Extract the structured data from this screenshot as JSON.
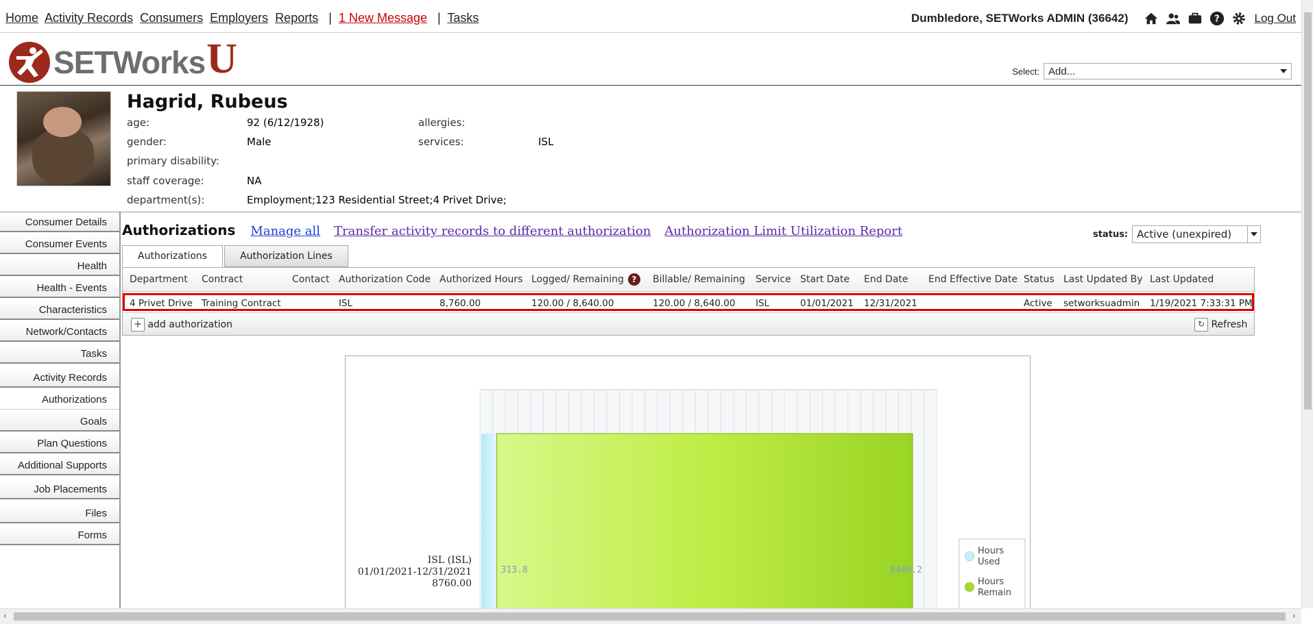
{
  "nav": {
    "home": "Home",
    "activity_records": "Activity Records",
    "consumers": "Consumers",
    "employers": "Employers",
    "reports": "Reports",
    "sep": "|",
    "new_message": "1 New Message",
    "tasks": "Tasks",
    "user": "Dumbledore, SETWorks ADMIN  (36642)",
    "logout": "Log Out"
  },
  "logo": {
    "word": "SETWorks",
    "u": "U"
  },
  "select": {
    "label": "Select:",
    "value": "Add..."
  },
  "consumer": {
    "name": "Hagrid, Rubeus",
    "age_label": "age:",
    "age": "92 (6/12/1928)",
    "allergies_label": "allergies:",
    "allergies": "",
    "gender_label": "gender:",
    "gender": "Male",
    "services_label": "services:",
    "services": "ISL",
    "primary_disability_label": "primary disability:",
    "primary_disability": "",
    "staff_coverage_label": "staff coverage:",
    "staff_coverage": "NA",
    "departments_label": "department(s):",
    "departments": "Employment;123 Residential Street;4 Privet Drive;"
  },
  "sidebar": {
    "items": [
      {
        "label": "Consumer Details"
      },
      {
        "label": "Consumer Events"
      },
      {
        "label": "Health"
      },
      {
        "label": "Health - Events"
      },
      {
        "label": "Characteristics"
      },
      {
        "label": "Network/Contacts"
      },
      {
        "label": "Tasks"
      },
      {
        "label": "Activity Records"
      },
      {
        "label": "Authorizations"
      },
      {
        "label": "Goals"
      },
      {
        "label": "Plan Questions"
      },
      {
        "label": "Additional Supports"
      },
      {
        "label": "Job Placements"
      },
      {
        "label": "Files"
      },
      {
        "label": "Forms"
      }
    ]
  },
  "main": {
    "title": "Authorizations",
    "link_manage": "Manage all",
    "link_transfer": "Transfer activity records to different authorization",
    "link_report": "Authorization Limit Utilization Report",
    "status_label": "status:",
    "status_value": "Active (unexpired)",
    "tabs": [
      {
        "label": "Authorizations"
      },
      {
        "label": "Authorization Lines"
      }
    ],
    "columns": [
      "Department",
      "Contract",
      "Contact",
      "Authorization Code",
      "Authorized Hours",
      "Logged/ Remaining",
      "Billable/ Remaining",
      "Service",
      "Start Date",
      "End Date",
      "End Effective Date",
      "Status",
      "Last Updated By",
      "Last Updated"
    ],
    "row": {
      "department": "4 Privet Drive",
      "contract": "Training Contract",
      "contact": "",
      "auth_code": "ISL",
      "authorized_hours": "8,760.00",
      "logged_remaining": "120.00 / 8,640.00",
      "billable_remaining": "120.00 / 8,640.00",
      "service": "ISL",
      "start_date": "01/01/2021",
      "end_date": "12/31/2021",
      "end_effective_date": "",
      "status": "Active",
      "last_updated_by": "setworksuadmin",
      "last_updated": "1/19/2021 7:33:31 PM"
    },
    "add_authorization": "add authorization",
    "refresh": "Refresh",
    "help_glyph": "?",
    "add_glyph": "+"
  },
  "chart_data": {
    "type": "bar",
    "orientation": "horizontal",
    "stacked": true,
    "categories": [
      "ISL (ISL)\n01/01/2021-12/31/2021\n8760.00"
    ],
    "category_lines": [
      "ISL (ISL)",
      "01/01/2021-12/31/2021",
      "8760.00"
    ],
    "series": [
      {
        "name": "Hours Used",
        "values": [
          313.8
        ],
        "color": "#c8eefb"
      },
      {
        "name": "Hours Remain",
        "values": [
          8446.2
        ],
        "color": "#a8d82a"
      }
    ],
    "value_labels": [
      "313.8",
      "8446.2"
    ],
    "legend_lines": [
      [
        "Hours",
        "Used"
      ],
      [
        "Hours",
        "Remain"
      ]
    ],
    "legend_position": "right",
    "xlim": [
      0,
      8760
    ],
    "grid": true
  },
  "colors": {
    "accent_red": "#e00000",
    "brand_red": "#9b2a1d",
    "link_blue": "#1a3fd6",
    "link_purple": "#5a2aa6"
  },
  "icons": [
    "home-icon",
    "users-icon",
    "briefcase-icon",
    "help-icon",
    "gear-icon",
    "refresh-icon",
    "plus-icon",
    "dropdown-arrow-icon"
  ]
}
